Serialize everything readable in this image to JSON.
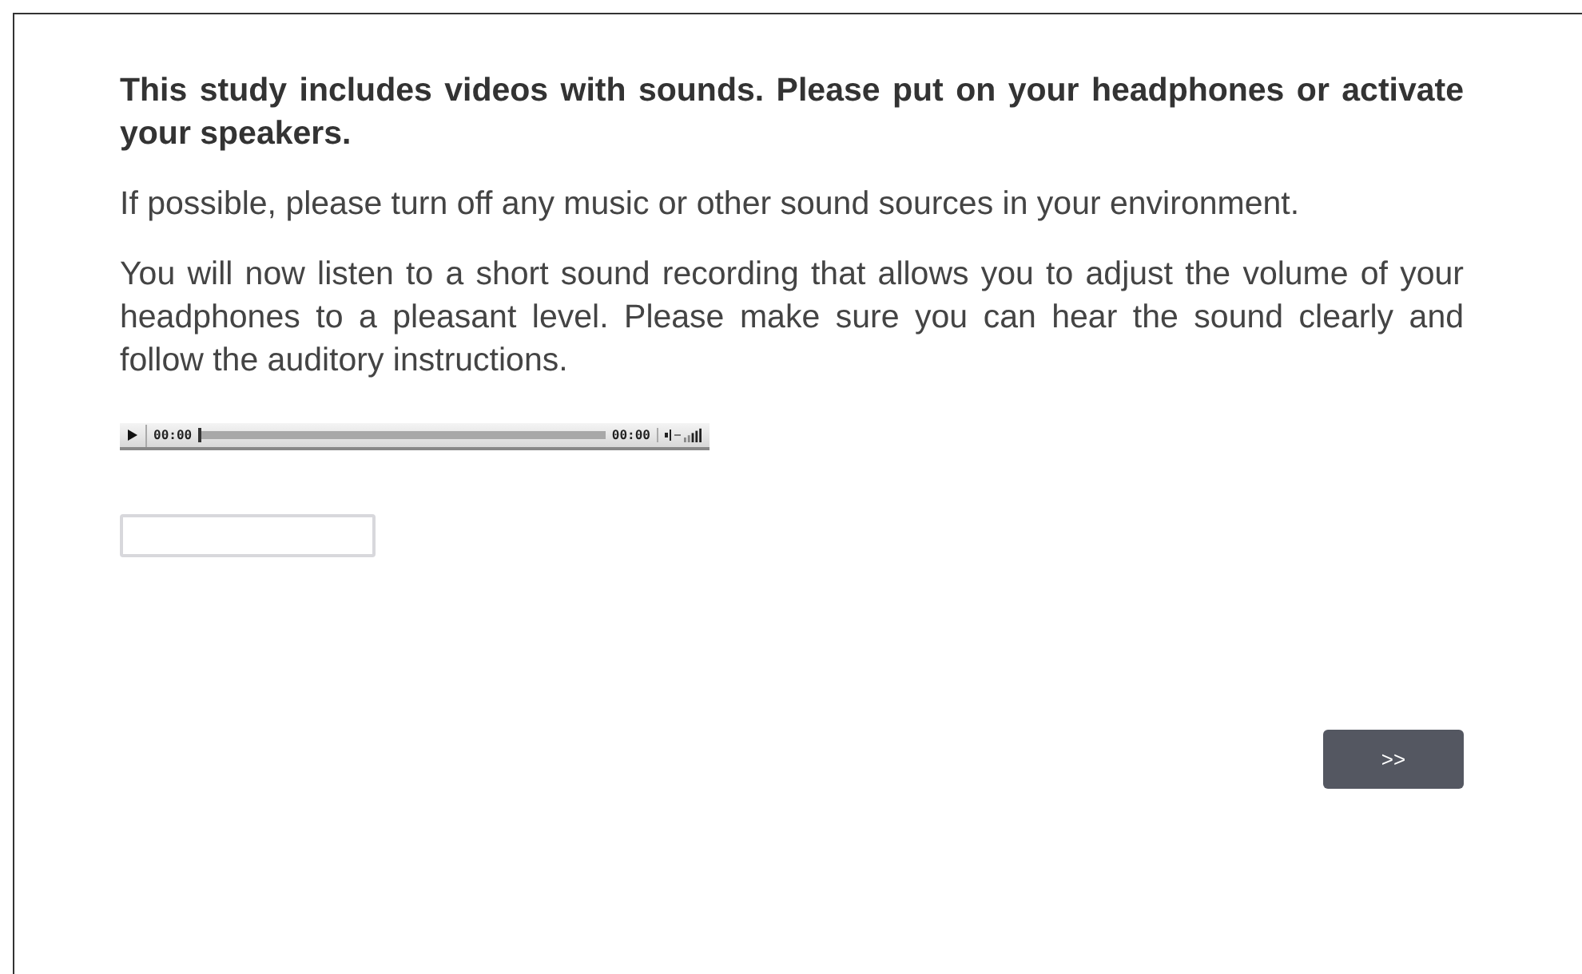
{
  "paragraphs": [
    {
      "kind": "bold",
      "text": "This study includes videos with sounds. Please put on your headphones or activate your speakers."
    },
    {
      "kind": "normal",
      "text": "If possible, please turn off any music or other sound sources in your environment."
    },
    {
      "kind": "normal",
      "text": "You will now listen to a short sound recording that allows you to adjust the volume of your headphones to a pleasant level. Please make sure you can hear the sound clearly and follow the auditory instructions."
    }
  ],
  "audio_player": {
    "current_time": "00:00",
    "duration": "00:00",
    "level": 0
  },
  "next_button": {
    "label": ">>"
  }
}
